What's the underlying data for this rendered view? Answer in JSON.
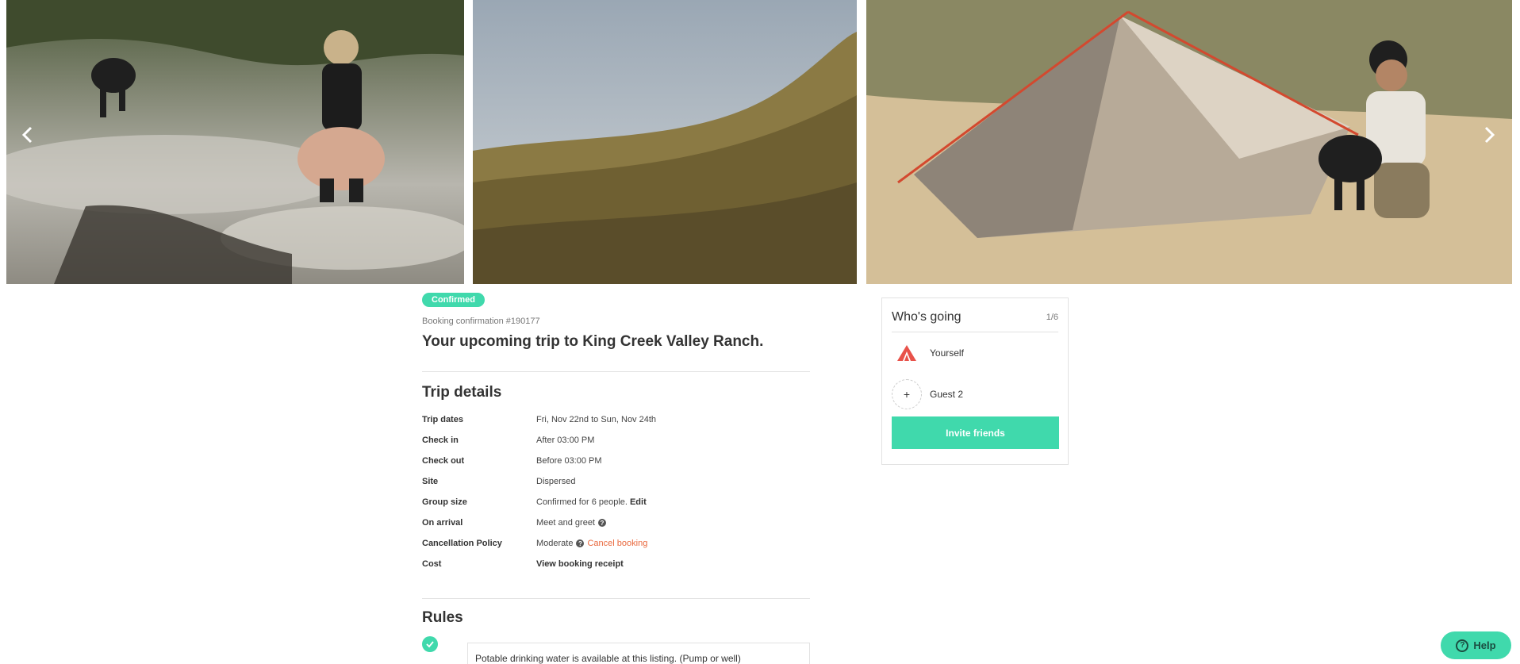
{
  "gallery": {
    "photos": [
      {
        "name": "woman-by-creek-photo"
      },
      {
        "name": "grassy-hillside-photo"
      },
      {
        "name": "man-with-dog-and-tent-photo"
      }
    ],
    "prev_icon": "chevron-left-icon",
    "next_icon": "chevron-right-icon"
  },
  "booking": {
    "status_badge": "Confirmed",
    "confirmation": "Booking confirmation #190177",
    "title": "Your upcoming trip to King Creek Valley Ranch."
  },
  "trip_details": {
    "title": "Trip details",
    "rows": [
      {
        "label": "Trip dates",
        "value": "Fri, Nov 22nd to Sun, Nov 24th"
      },
      {
        "label": "Check in",
        "value": "After 03:00 PM"
      },
      {
        "label": "Check out",
        "value": "Before 03:00 PM"
      },
      {
        "label": "Site",
        "value": "Dispersed"
      },
      {
        "label": "Group size",
        "value": "Confirmed for 6 people.",
        "action": "Edit"
      },
      {
        "label": "On arrival",
        "value": "Meet and greet"
      },
      {
        "label": "Cancellation Policy",
        "value": "Moderate",
        "action": "Cancel booking"
      },
      {
        "label": "Cost",
        "action": "View booking receipt"
      }
    ]
  },
  "rules": {
    "title": "Rules",
    "items": [
      {
        "text": "Potable drinking water is available at this listing. (Pump or well)"
      }
    ]
  },
  "whos_going": {
    "title": "Who's going",
    "count": "1/6",
    "guests": [
      {
        "name": "Yourself",
        "icon": "hipcamp-logo-icon"
      },
      {
        "name": "Guest 2",
        "icon": "plus-icon",
        "glyph": "+"
      }
    ],
    "invite_label": "Invite friends"
  },
  "help": {
    "label": "Help",
    "glyph": "?"
  },
  "colors": {
    "accent": "#40d9ac",
    "link_orange": "#e9683d",
    "logo_red": "#e8524a"
  }
}
